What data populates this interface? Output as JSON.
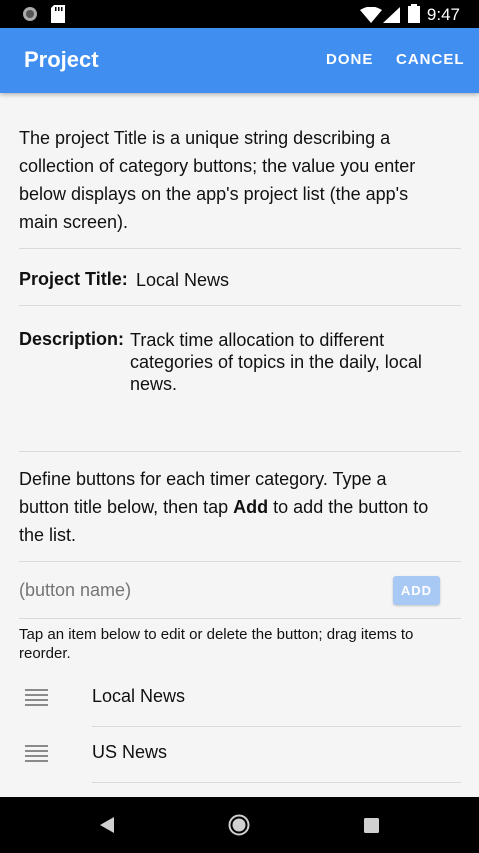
{
  "status": {
    "time": "9:47"
  },
  "appbar": {
    "title": "Project",
    "done_label": "DONE",
    "cancel_label": "CANCEL"
  },
  "intro": "The project Title is a unique string describing a collection of category buttons; the value you enter below displays on the app's project list (the app's main screen).",
  "project_title": {
    "label": "Project Title:",
    "value": "Local News"
  },
  "description": {
    "label": "Description:",
    "value": "Track time allocation to different categories of topics in the daily, local news."
  },
  "define": {
    "prefix": "Define buttons for each timer category. Type a button title below, then tap ",
    "bold": "Add",
    "suffix": " to add the button to the list."
  },
  "button_input": {
    "placeholder": "(button name)"
  },
  "add_label": "ADD",
  "hint": "Tap an item below to edit or delete the button; drag items to reorder.",
  "items": [
    {
      "label": "Local News"
    },
    {
      "label": "US News"
    }
  ]
}
